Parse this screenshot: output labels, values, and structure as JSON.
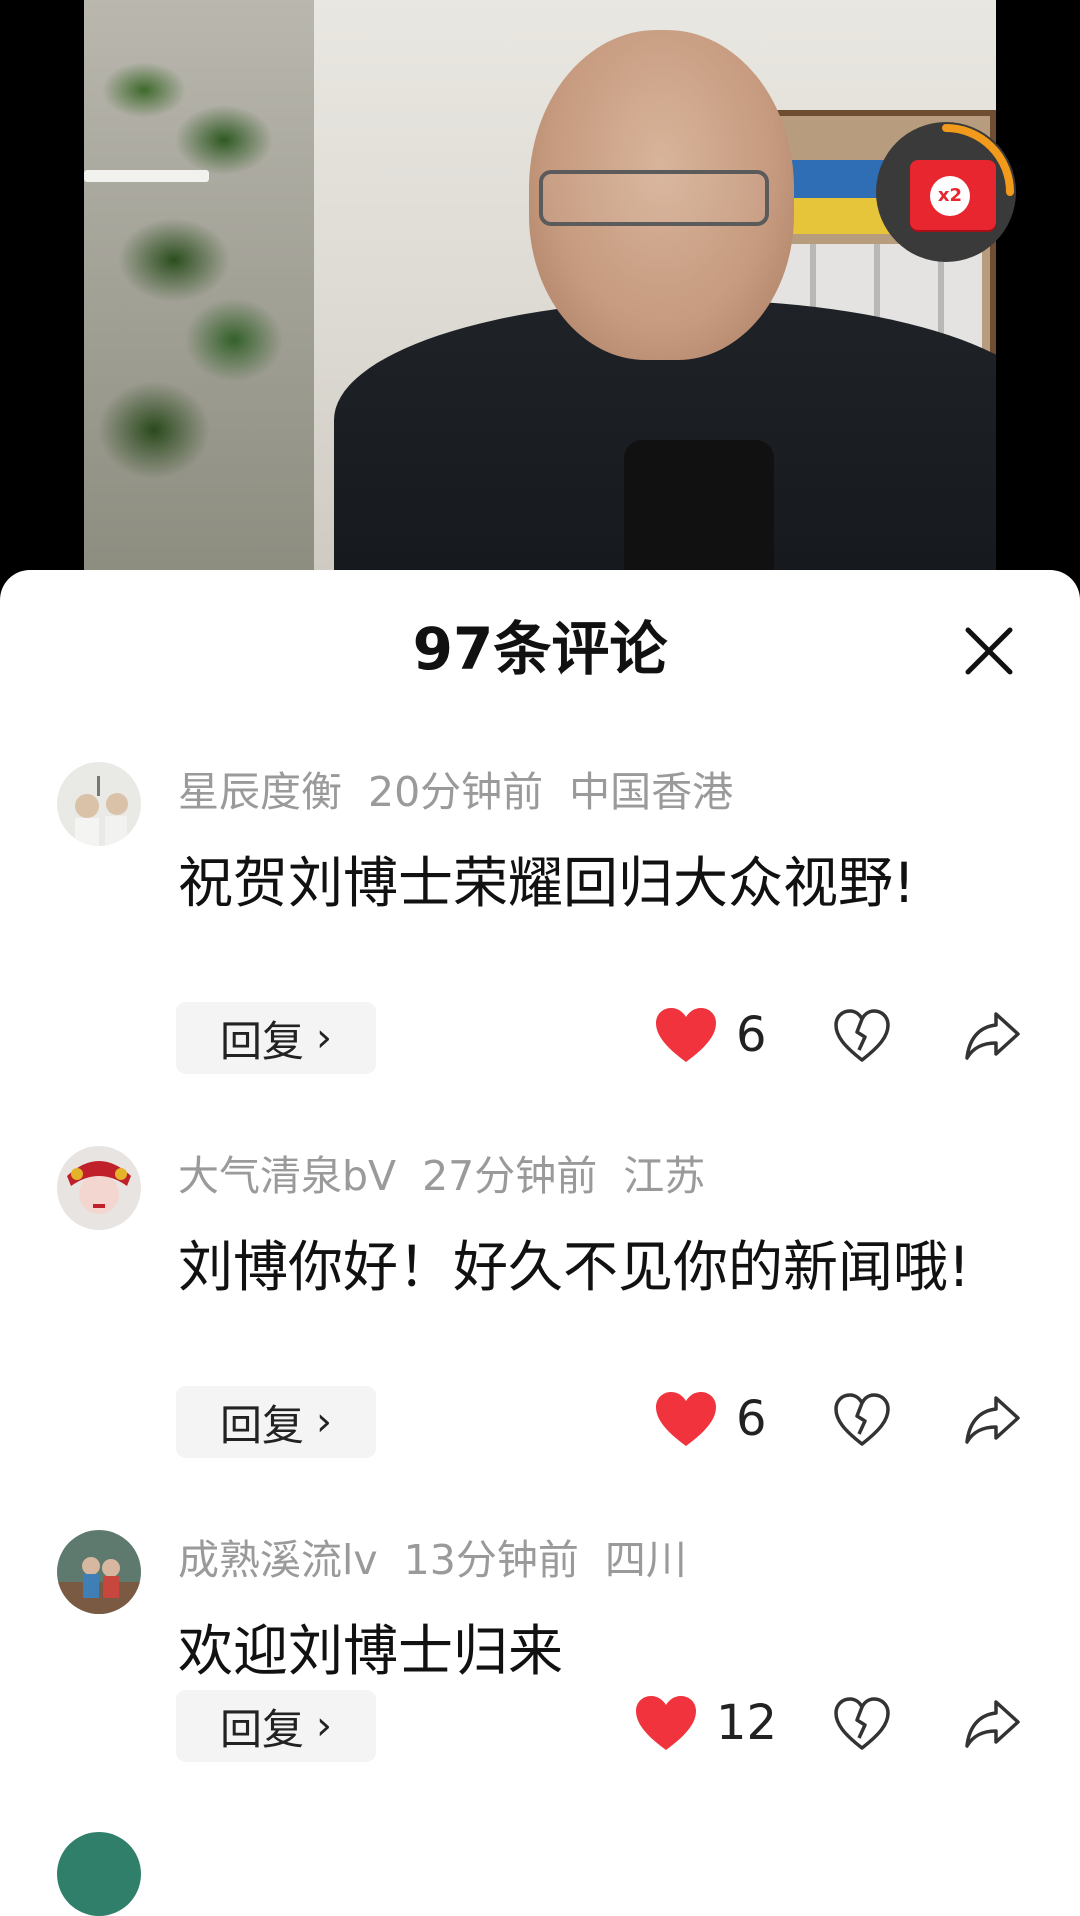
{
  "video": {
    "redpacket_badge": "x2",
    "colors": {
      "redpacket": "#e8262f",
      "redpacket_ring": "#f29a1b"
    }
  },
  "sheet": {
    "title": "97条评论",
    "close_icon": "close-icon"
  },
  "comments": [
    {
      "username": "星辰度衡",
      "time": "20分钟前",
      "location": "中国香港",
      "text": "祝贺刘博士荣耀回归大众视野!",
      "reply_label": "回复",
      "likes": "6"
    },
    {
      "username": "大气清泉bV",
      "time": "27分钟前",
      "location": "江苏",
      "text": "刘博你好！好久不见你的新闻哦!",
      "reply_label": "回复",
      "likes": "6"
    },
    {
      "username": "成熟溪流lv",
      "time": "13分钟前",
      "location": "四川",
      "text": "欢迎刘博士归来",
      "reply_label": "回复",
      "likes": "12"
    }
  ],
  "colors": {
    "like_red": "#f0333c",
    "meta_gray": "#9a9a9a",
    "text": "#111111"
  }
}
